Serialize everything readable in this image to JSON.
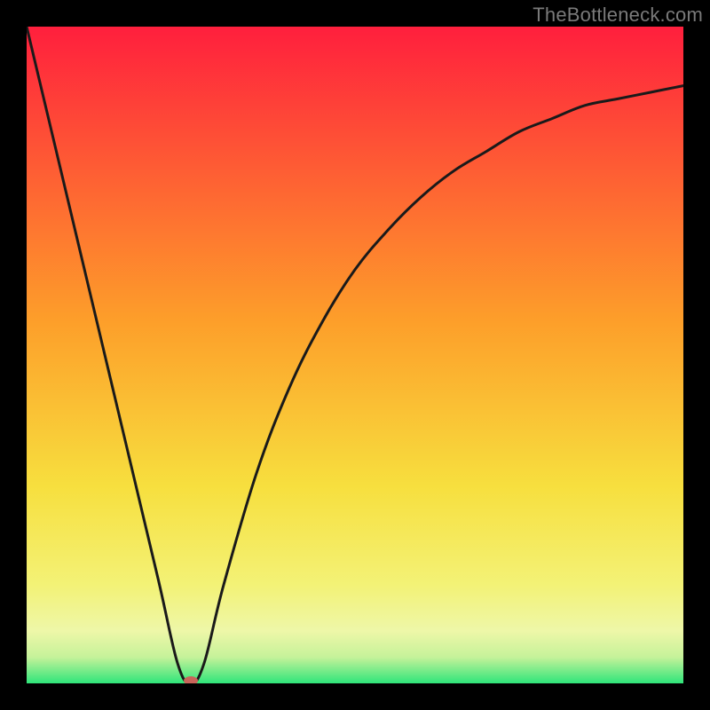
{
  "watermark": "TheBottleneck.com",
  "chart_data": {
    "type": "line",
    "title": "",
    "xlabel": "",
    "ylabel": "",
    "ylim": [
      0,
      100
    ],
    "xlim": [
      0,
      100
    ],
    "x": [
      0,
      5,
      10,
      15,
      20,
      23,
      25,
      27,
      30,
      35,
      40,
      45,
      50,
      55,
      60,
      65,
      70,
      75,
      80,
      85,
      90,
      95,
      100
    ],
    "values": [
      100,
      79,
      58,
      37,
      16,
      3,
      0,
      3,
      15,
      32,
      45,
      55,
      63,
      69,
      74,
      78,
      81,
      84,
      86,
      88,
      89,
      90,
      91
    ],
    "minimum_marker": {
      "x": 25,
      "y": 0
    },
    "background_gradient": {
      "stops": [
        {
          "pct": 0,
          "color": "#ff1f3d"
        },
        {
          "pct": 45,
          "color": "#fd9f2a"
        },
        {
          "pct": 70,
          "color": "#f7df3e"
        },
        {
          "pct": 85,
          "color": "#f3f276"
        },
        {
          "pct": 92,
          "color": "#eef7a8"
        },
        {
          "pct": 96,
          "color": "#c6f29a"
        },
        {
          "pct": 100,
          "color": "#2fe57a"
        }
      ]
    }
  }
}
